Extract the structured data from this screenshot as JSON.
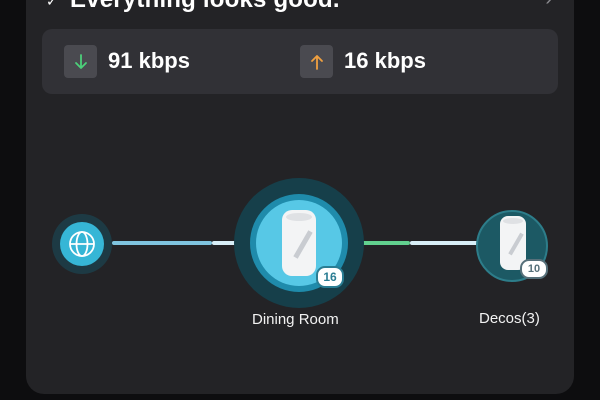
{
  "status": {
    "message": "Everything looks good.",
    "icon": "check-icon",
    "chevron_icon": "chevron-right-icon"
  },
  "speed": {
    "download": {
      "value": "91 kbps",
      "icon": "download-arrow-icon",
      "color": "#4cd07a"
    },
    "upload": {
      "value": "16 kbps",
      "icon": "upload-arrow-icon",
      "color": "#f0a040"
    }
  },
  "topology": {
    "internet": {
      "icon": "globe-icon",
      "color": "#36b6d6"
    },
    "main_deco": {
      "name": "Dining Room",
      "clients": "16",
      "icon": "deco-device-icon"
    },
    "satellite": {
      "name": "Decos(3)",
      "clients": "10",
      "icon": "deco-device-icon"
    },
    "link_colors": {
      "wan": "#7fc4df",
      "backhaul_good": "#62d18f",
      "backhaul": "#d8eef7"
    }
  },
  "colors": {
    "background": "#0d0d0f",
    "card": "#232326",
    "panel": "#313136",
    "accent": "#57c8e6"
  }
}
